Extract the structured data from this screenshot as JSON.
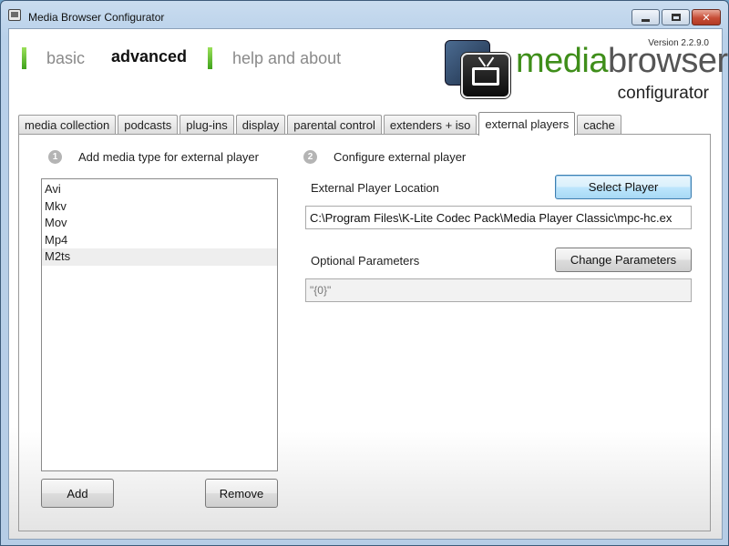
{
  "window": {
    "title": "Media Browser Configurator",
    "controls": {
      "minimize": "minimize",
      "maximize": "maximize",
      "close": "✕"
    }
  },
  "nav": {
    "items": [
      {
        "label": "basic",
        "active": false
      },
      {
        "label": "advanced",
        "active": true
      },
      {
        "label": "help and about",
        "active": false
      }
    ]
  },
  "logo": {
    "version": "Version 2.2.9.0",
    "brand_media": "media",
    "brand_browser": "browser",
    "subtitle": "configurator"
  },
  "tabs": [
    {
      "label": "media collection"
    },
    {
      "label": "podcasts"
    },
    {
      "label": "plug-ins"
    },
    {
      "label": "display"
    },
    {
      "label": "parental control"
    },
    {
      "label": "extenders + iso"
    },
    {
      "label": "external players",
      "active": true
    },
    {
      "label": "cache"
    }
  ],
  "external_players": {
    "step1": {
      "number": "1",
      "label": "Add media type for external player"
    },
    "step2": {
      "number": "2",
      "label": "Configure external player"
    },
    "media_types": [
      "Avi",
      "Mkv",
      "Mov",
      "Mp4",
      "M2ts"
    ],
    "selected_media_type": "M2ts",
    "add_button": "Add",
    "remove_button": "Remove",
    "location_label": "External Player Location",
    "select_player_button": "Select Player",
    "location_value": "C:\\Program Files\\K-Lite Codec Pack\\Media Player Classic\\mpc-hc.ex",
    "params_label": "Optional Parameters",
    "change_params_button": "Change Parameters",
    "params_value": "\"{0}\""
  },
  "colors": {
    "accent_green": "#3f8e1a",
    "nav_marker": "#5cc22c",
    "close_red": "#c74d36"
  }
}
